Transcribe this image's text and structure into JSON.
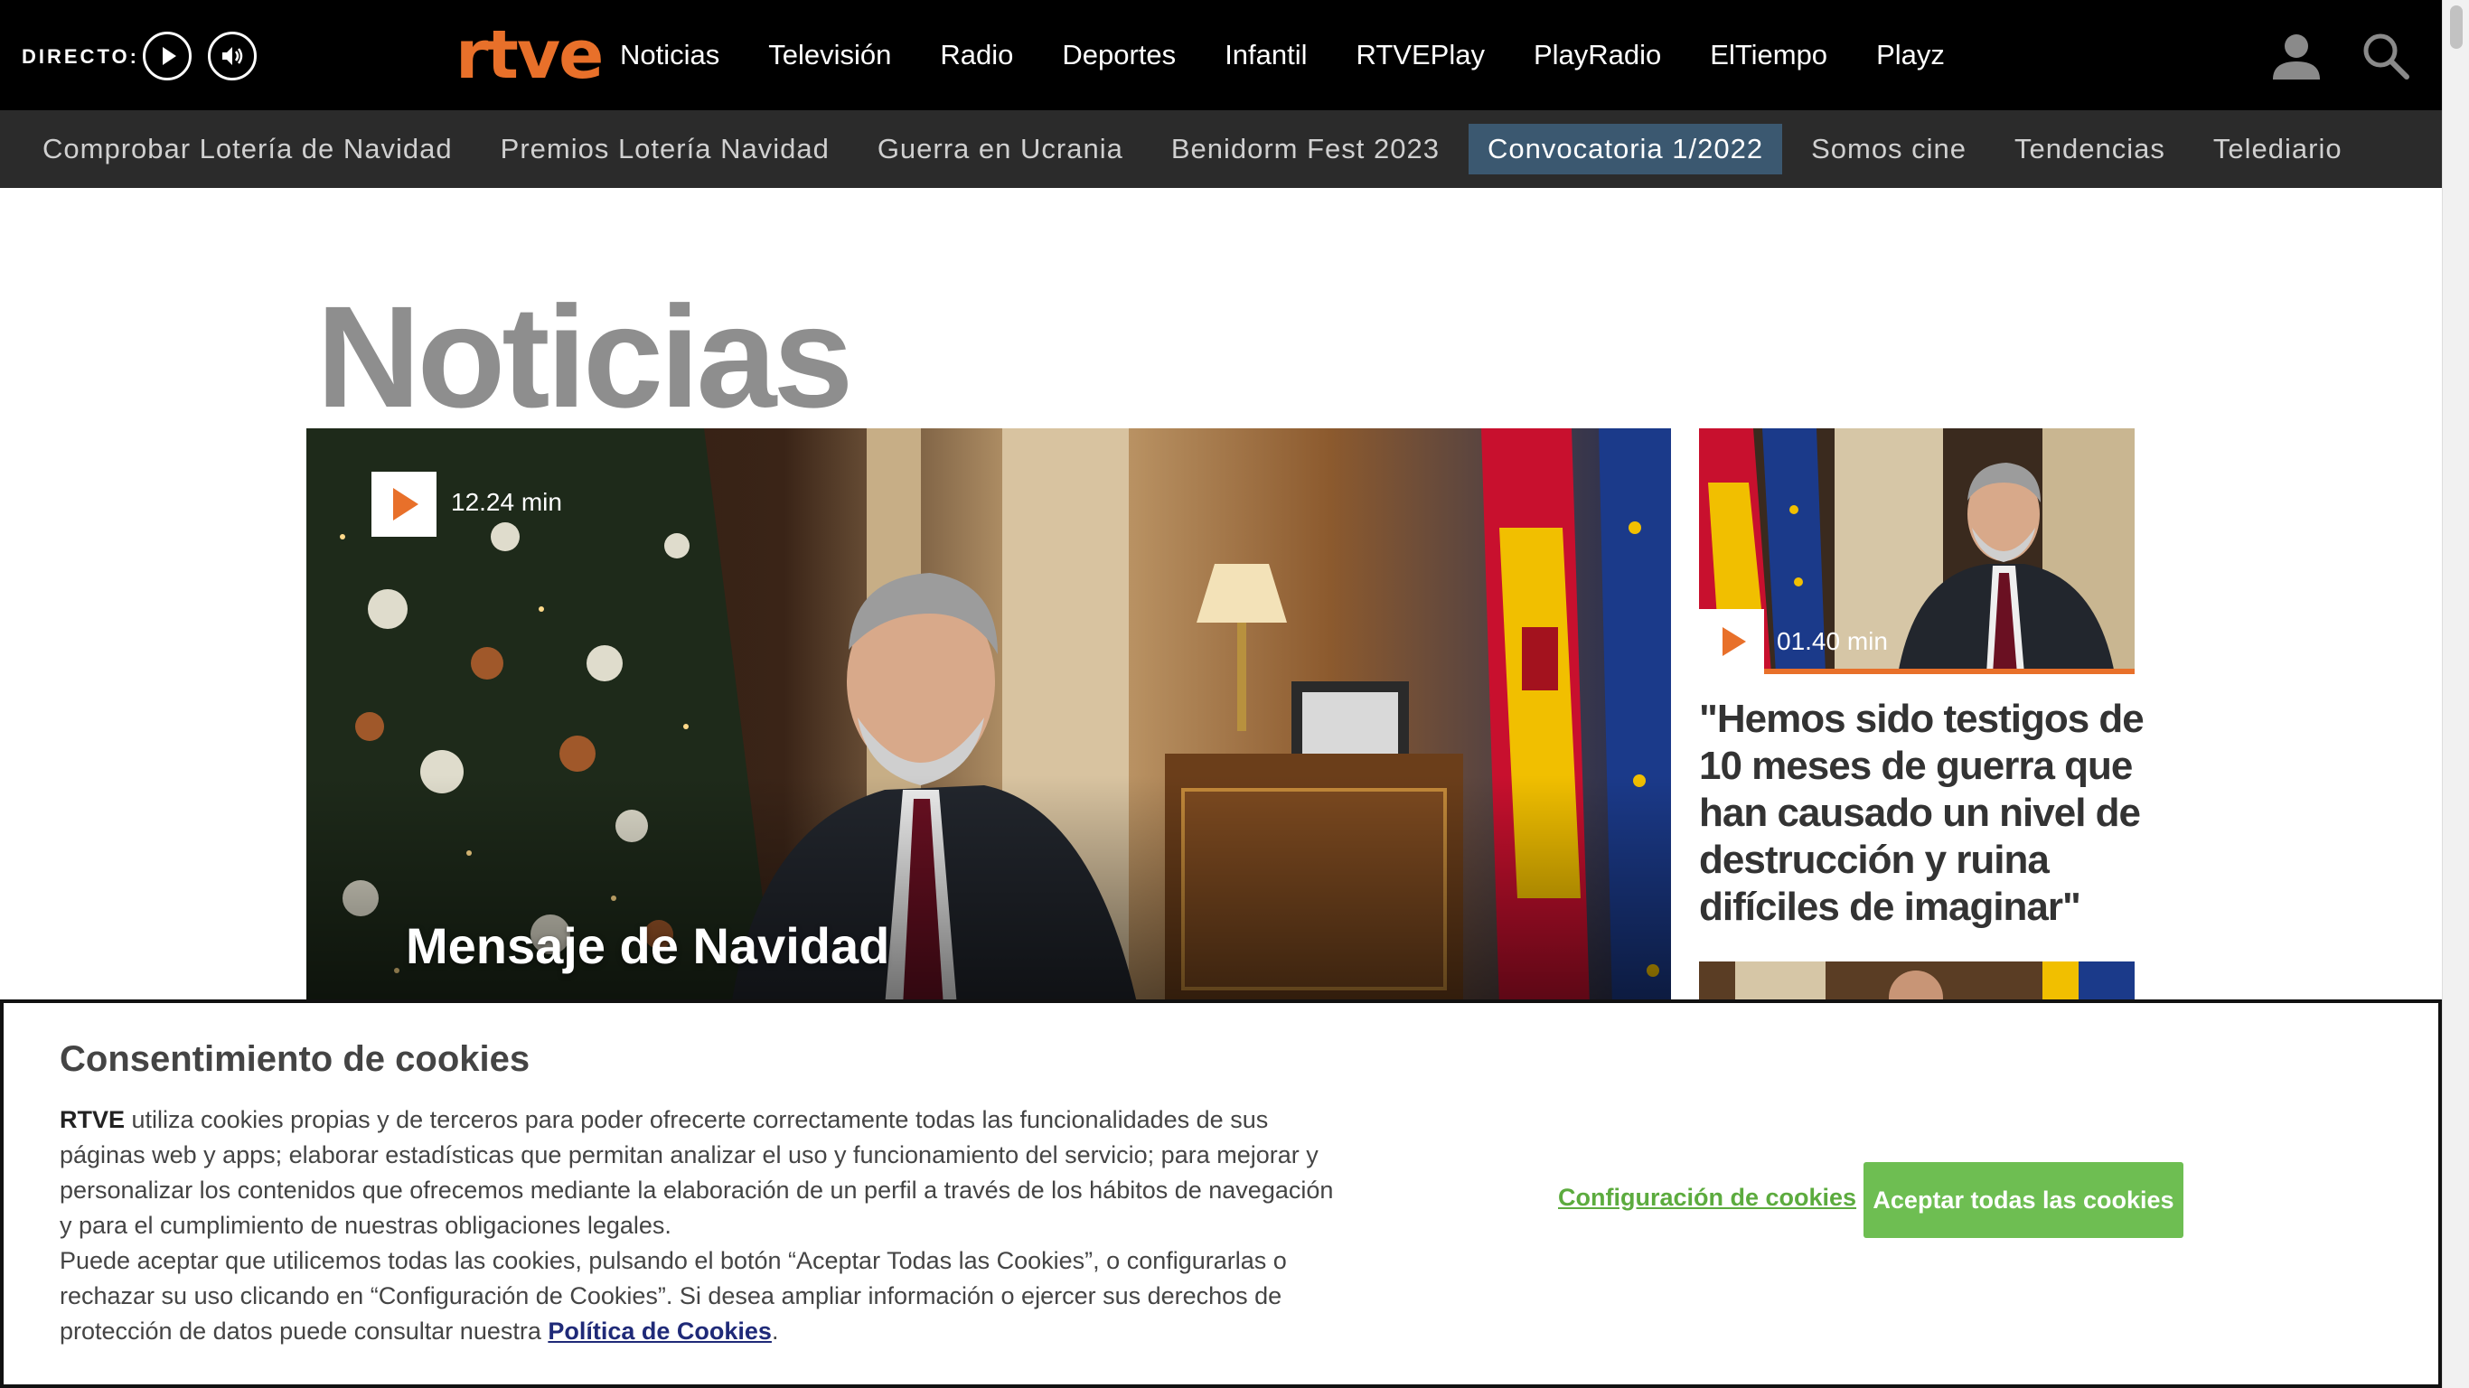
{
  "header": {
    "live_label": "DIRECTO:",
    "logo": "rtve",
    "nav": [
      "Noticias",
      "Televisión",
      "Radio",
      "Deportes",
      "Infantil",
      "RTVEPlay",
      "PlayRadio",
      "ElTiempo",
      "Playz"
    ]
  },
  "subnav": {
    "items": [
      "Comprobar Lotería de Navidad",
      "Premios Lotería Navidad",
      "Guerra en Ucrania",
      "Benidorm Fest 2023",
      "Convocatoria 1/2022",
      "Somos cine",
      "Tendencias",
      "Telediario"
    ],
    "active": "Convocatoria 1/2022"
  },
  "page": {
    "title": "Noticias"
  },
  "hero": {
    "duration": "12.24 min",
    "headline": "Mensaje de Navidad"
  },
  "side_story": {
    "duration": "01.40 min",
    "headline": "\"Hemos sido testigos de 10 meses de guerra que han causado un nivel de destrucción y ruina difíciles de imaginar\""
  },
  "cookies": {
    "title": "Consentimiento de cookies",
    "brand": "RTVE",
    "text_1": " utiliza cookies propias y de terceros para poder ofrecerte correctamente todas las funcionalidades de sus páginas web y apps; elaborar estadísticas que permitan analizar el uso y funcionamiento del servicio; para mejorar y personalizar los contenidos que ofrecemos mediante la elaboración de un perfil a través de los hábitos de navegación y para el cumplimiento de nuestras obligaciones legales.",
    "text_2": "Puede aceptar que utilicemos todas las cookies, pulsando el botón “Aceptar Todas las Cookies”, o configurarlas o rechazar su uso clicando en “Configuración de Cookies”. Si desea ampliar información o ejercer sus derechos de protección de datos puede consultar nuestra ",
    "policy_link": "Política de Cookies",
    "period": ".",
    "settings_button": "Configuración de cookies",
    "accept_button": "Aceptar todas las cookies"
  },
  "colors": {
    "brand_orange": "#e8702a",
    "accept_green": "#6ebe52",
    "active_tab": "#3b5870"
  },
  "icons": {
    "play": "play-icon",
    "audio": "speaker-icon",
    "user": "user-icon",
    "search": "search-icon"
  }
}
